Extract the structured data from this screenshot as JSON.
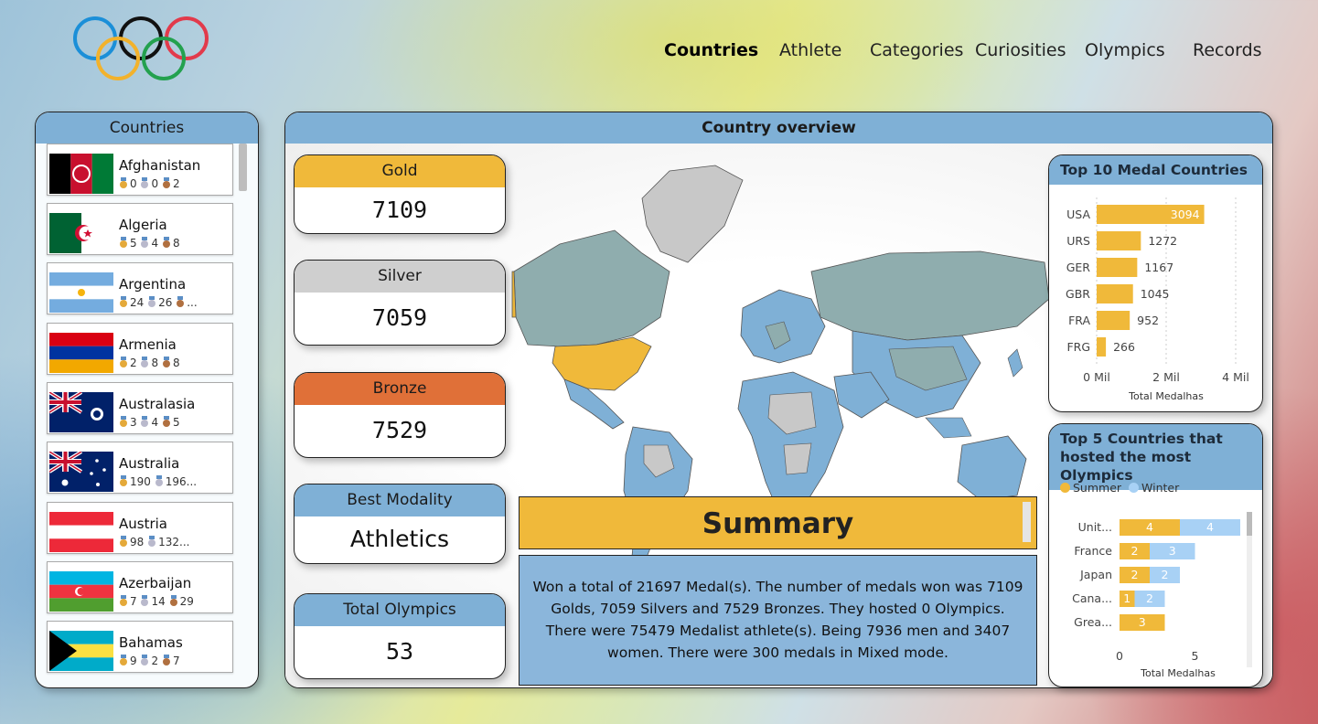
{
  "nav": {
    "items": [
      {
        "label": "Countries",
        "active": true
      },
      {
        "label": "Athlete",
        "active": false
      },
      {
        "label": "Categories",
        "active": false
      },
      {
        "label": "Curiosities",
        "active": false
      },
      {
        "label": "Olympics",
        "active": false
      },
      {
        "label": "Records",
        "active": false
      }
    ]
  },
  "colors": {
    "gold": "#f0b93a",
    "silver": "#cfcfcf",
    "bronze": "#e07038",
    "blue": "#7fb0d6",
    "summer": "#f0b93a",
    "winter": "#a8d1f5"
  },
  "countries_panel": {
    "title": "Countries",
    "items": [
      {
        "name": "Afghanistan",
        "medals": "0   0   2",
        "gold": "0",
        "silver": "0",
        "bronze": "2",
        "flag": "afghanistan"
      },
      {
        "name": "Algeria",
        "gold": "5",
        "silver": "4",
        "bronze": "8",
        "flag": "algeria"
      },
      {
        "name": "Argentina",
        "gold": "24",
        "silver": "26",
        "bronze": "...",
        "flag": "argentina"
      },
      {
        "name": "Armenia",
        "gold": "2",
        "silver": "8",
        "bronze": "8",
        "flag": "armenia"
      },
      {
        "name": "Australasia",
        "gold": "3",
        "silver": "4",
        "bronze": "5",
        "flag": "australasia"
      },
      {
        "name": "Australia",
        "gold": "190",
        "silver": "196...",
        "bronze": "",
        "flag": "australia"
      },
      {
        "name": "Austria",
        "gold": "98",
        "silver": "132...",
        "bronze": "",
        "flag": "austria"
      },
      {
        "name": "Azerbaijan",
        "gold": "7",
        "silver": "14",
        "bronze": "29",
        "flag": "azerbaijan"
      },
      {
        "name": "Bahamas",
        "gold": "9",
        "silver": "2",
        "bronze": "7",
        "flag": "bahamas"
      }
    ]
  },
  "overview": {
    "title": "Country overview",
    "kpis": {
      "gold": {
        "label": "Gold",
        "value": "7109"
      },
      "silver": {
        "label": "Silver",
        "value": "7059"
      },
      "bronze": {
        "label": "Bronze",
        "value": "7529"
      },
      "modality": {
        "label": "Best Modality",
        "value": "Athletics"
      },
      "olympics": {
        "label": "Total Olympics",
        "value": "53"
      }
    },
    "summary": {
      "title": "Summary",
      "text": "Won a total of 21697 Medal(s). The number of medals won was 7109 Golds, 7059 Silvers and 7529 Bronzes. They hosted 0 Olympics. There were 75479 Medalist athlete(s). Being 7936 men and 3407 women. There were 300 medals in Mixed mode."
    }
  },
  "chart_data": [
    {
      "type": "bar",
      "orientation": "horizontal",
      "title": "Top 10 Medal Countries",
      "categories": [
        "USA",
        "URS",
        "GER",
        "GBR",
        "FRA",
        "FRG"
      ],
      "values": [
        3094,
        1272,
        1167,
        1045,
        952,
        266
      ],
      "value_labels": [
        "3094",
        "1272",
        "1167",
        "1045",
        "952",
        "266"
      ],
      "xlabel": "Total Medalhas",
      "xticks": [
        "0 Mil",
        "2 Mil",
        "4 Mil"
      ],
      "xlim": [
        0,
        4000
      ]
    },
    {
      "type": "bar",
      "orientation": "horizontal",
      "stacked": true,
      "title": "Top 5 Countries that hosted the most Olympics",
      "legend": [
        "Summer",
        "Winter"
      ],
      "categories": [
        "Unit...",
        "France",
        "Japan",
        "Cana...",
        "Grea..."
      ],
      "series": [
        {
          "name": "Summer",
          "values": [
            4,
            2,
            2,
            1,
            3
          ]
        },
        {
          "name": "Winter",
          "values": [
            4,
            3,
            2,
            2,
            0
          ]
        }
      ],
      "xlabel": "Total Medalhas",
      "xticks": [
        "0",
        "5"
      ],
      "xlim": [
        0,
        8
      ]
    }
  ]
}
